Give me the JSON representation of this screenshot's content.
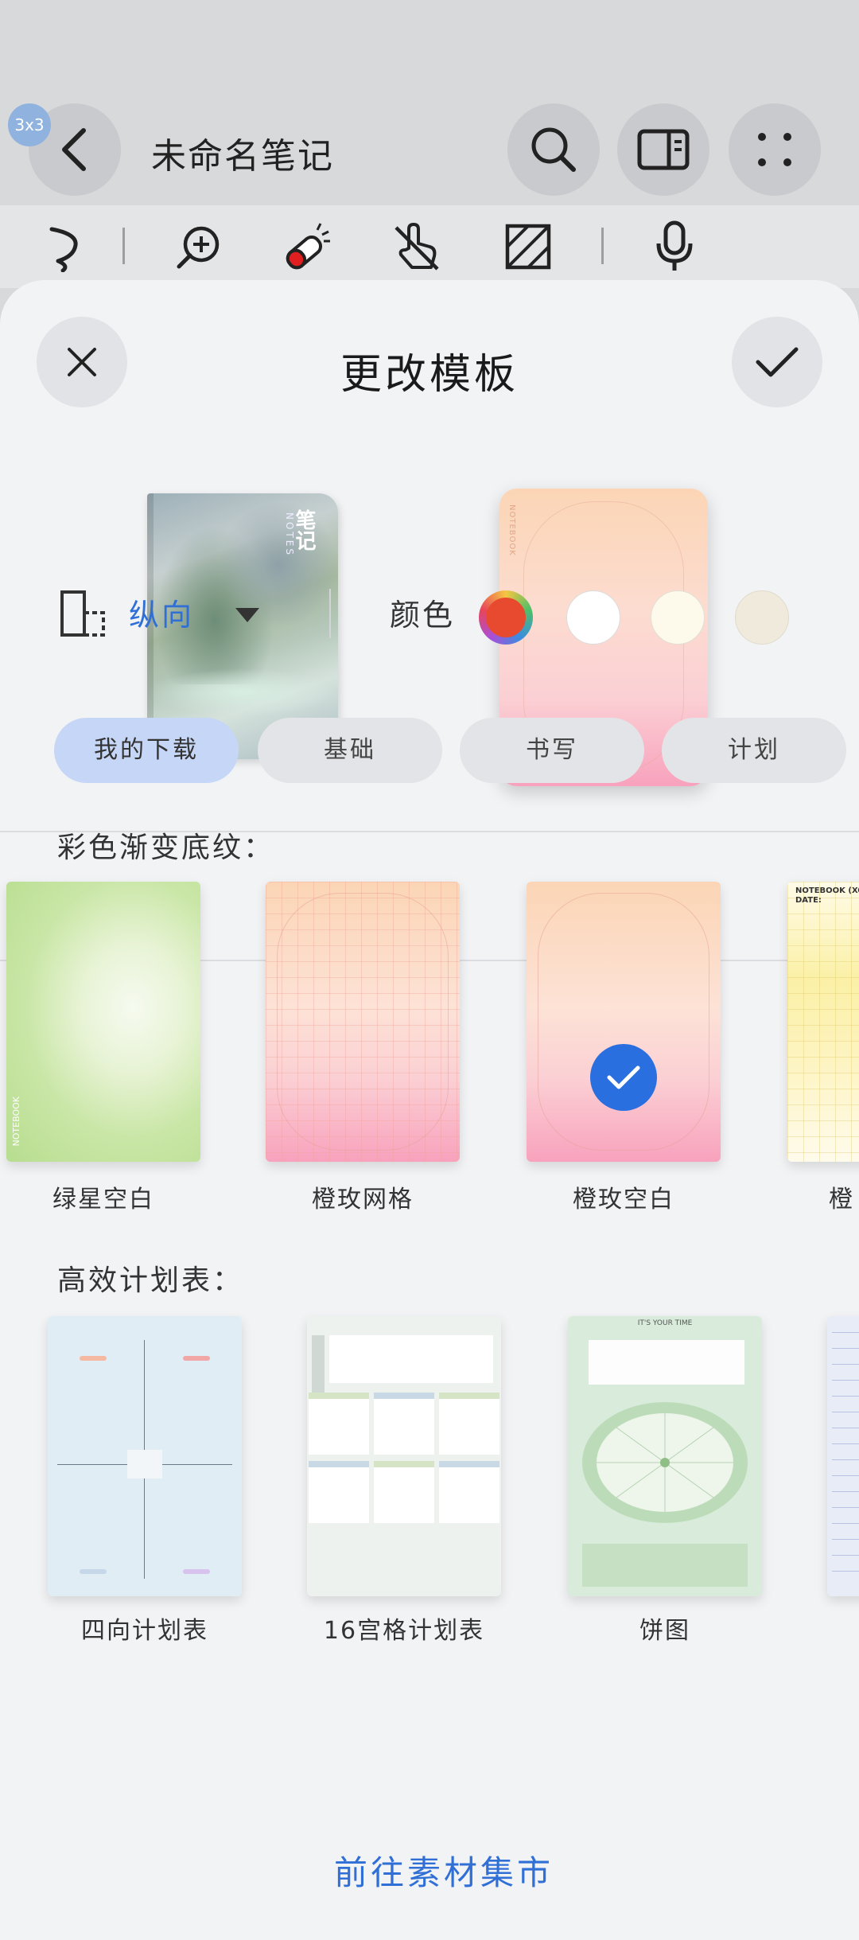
{
  "header": {
    "badge": "3x3",
    "title": "未命名笔记",
    "back_icon": "chevron-left-icon",
    "search_icon": "search-icon",
    "panel_icon": "sidebar-panel-icon",
    "more_icon": "more-dots-icon"
  },
  "toolbar": {
    "tools": [
      "lasso-icon",
      "zoom-in-icon",
      "eraser-icon",
      "hand-touch-icon",
      "shading-icon",
      "microphone-icon"
    ],
    "eraser_color": "#e02020"
  },
  "sheet": {
    "title": "更改模板",
    "close_icon": "close-icon",
    "confirm_icon": "check-icon",
    "cover": {
      "title": "笔记",
      "subtitle": "NOTES"
    },
    "paper_text": "NOTEBOOK"
  },
  "orientation": {
    "label": "纵向"
  },
  "colors": {
    "label": "颜色",
    "swatches": [
      "#multicolor",
      "#ffffff",
      "#fdfaec",
      "#efeadc"
    ]
  },
  "tabs": [
    {
      "label": "我的下载",
      "active": true
    },
    {
      "label": "基础",
      "active": false
    },
    {
      "label": "书写",
      "active": false
    },
    {
      "label": "计划",
      "active": false
    }
  ],
  "sections": [
    {
      "title": "彩色渐变底纹：",
      "items": [
        {
          "label": "绿星空白",
          "selected": false,
          "text": "NOTEBOOK"
        },
        {
          "label": "橙玫网格",
          "selected": false
        },
        {
          "label": "橙玫空白",
          "selected": true
        },
        {
          "label": "橙",
          "selected": false,
          "text": "NOTEBOOK (XO",
          "date": "DATE:"
        }
      ]
    },
    {
      "title": "高效计划表：",
      "items": [
        {
          "label": "四向计划表"
        },
        {
          "label": "16宫格计划表"
        },
        {
          "label": "饼图",
          "text": "IT'S YOUR TIME"
        },
        {
          "label": ""
        }
      ]
    }
  ],
  "market_link": "前往素材集市"
}
